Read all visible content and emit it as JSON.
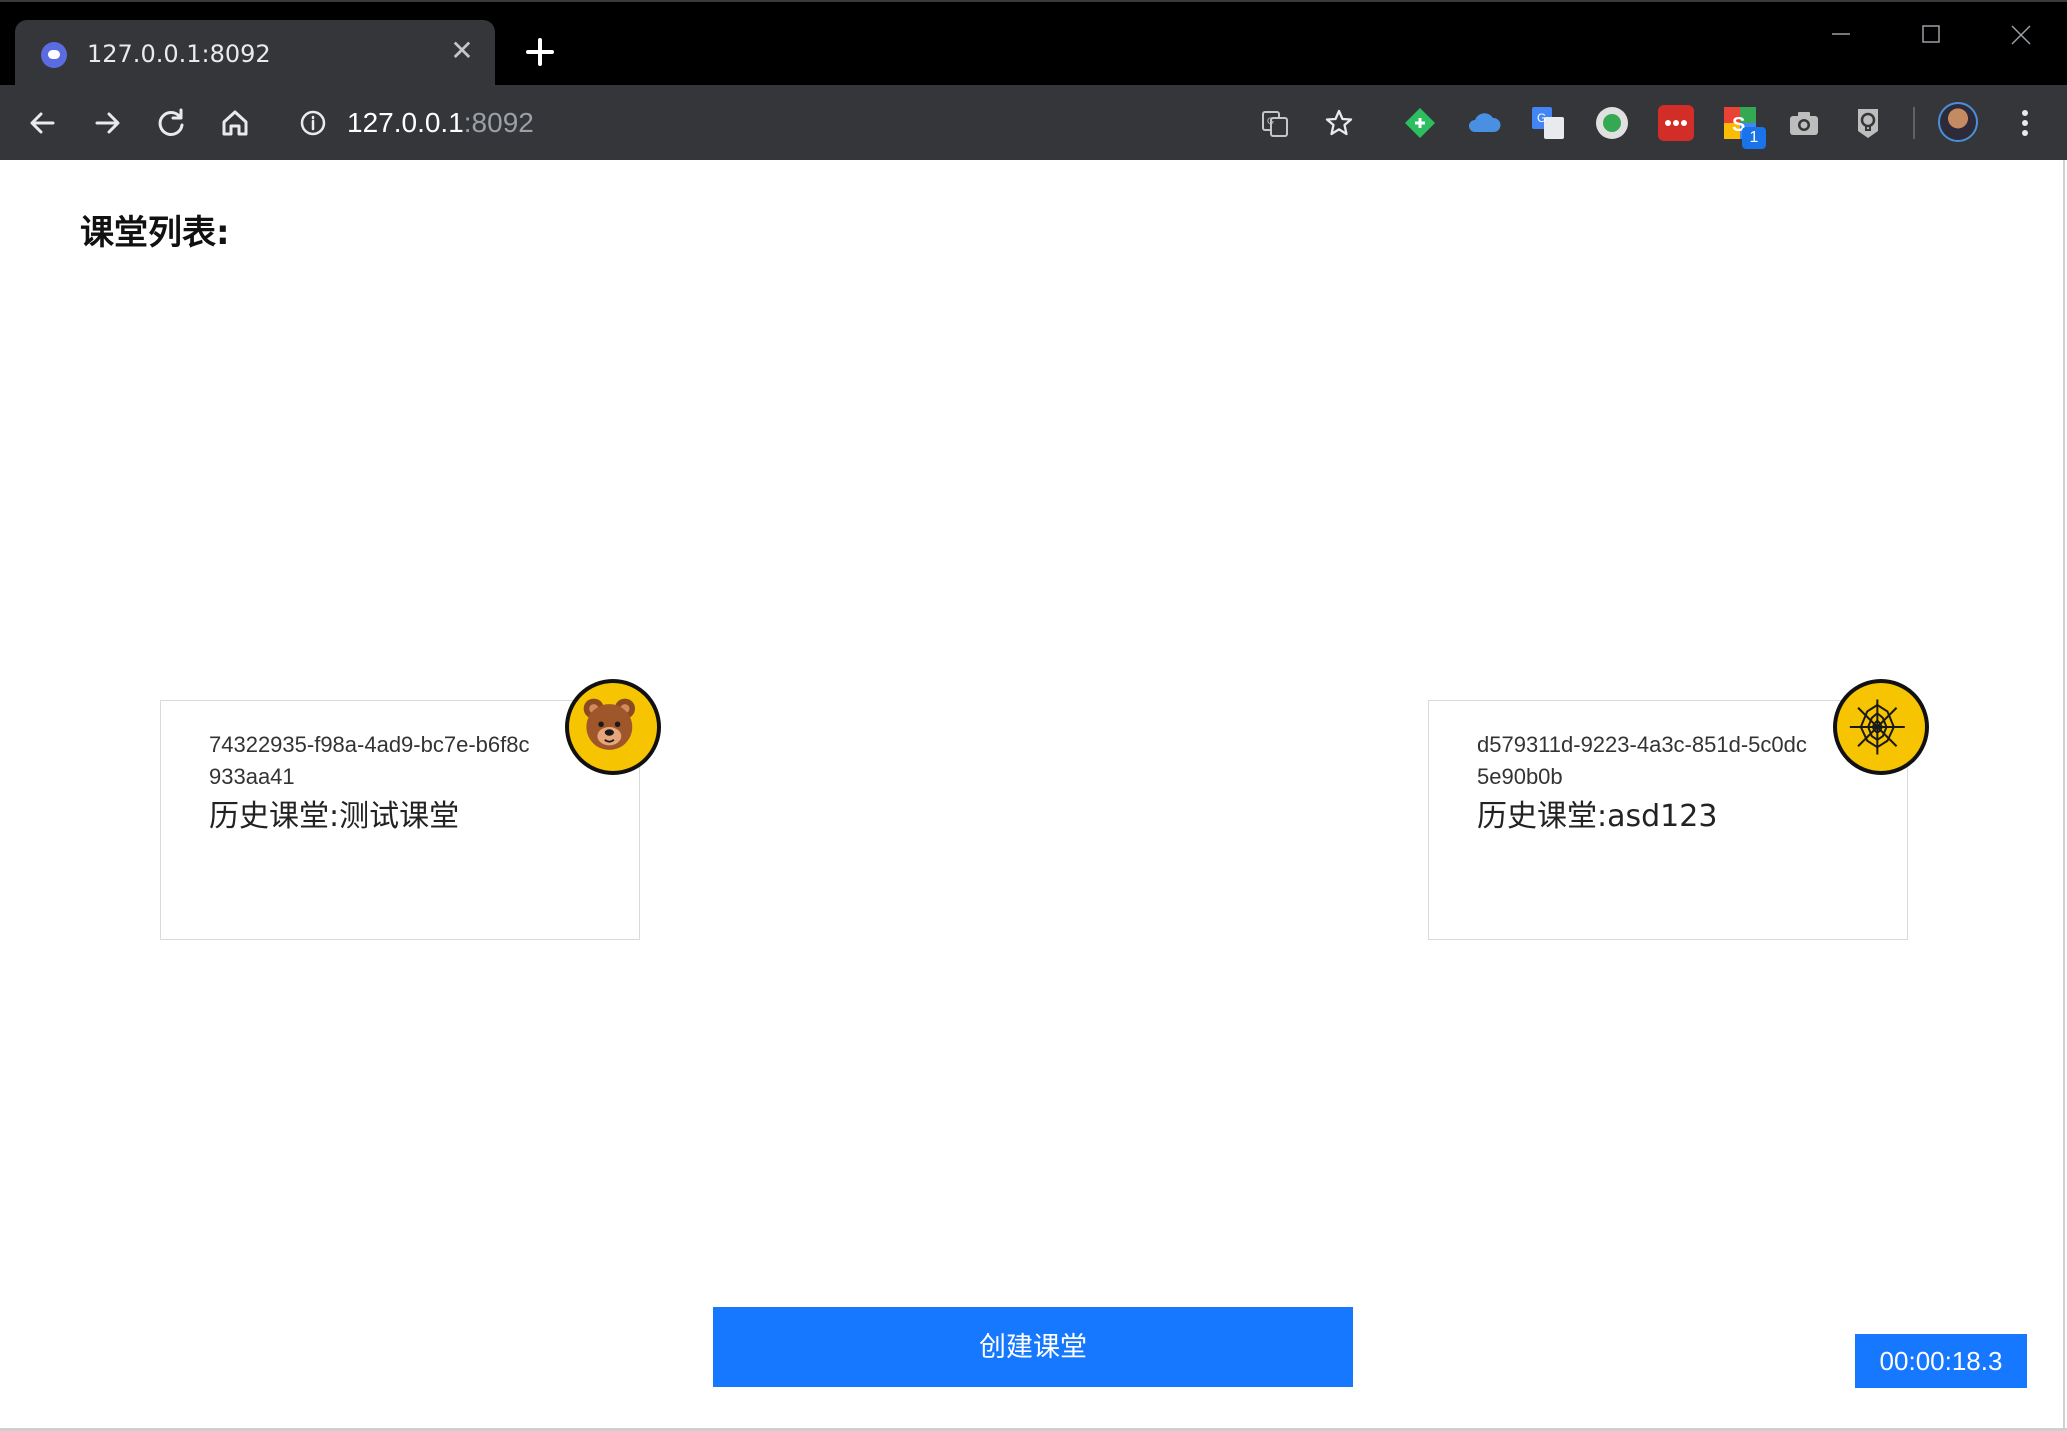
{
  "browser": {
    "tab_title": "127.0.0.1:8092",
    "url_host": "127.0.0.1",
    "url_port": ":8092",
    "extensions": [
      {
        "icon": "evernote-icon",
        "color": "#2dbe60"
      },
      {
        "icon": "cloud-icon",
        "color": "#4a90e2"
      },
      {
        "icon": "google-translate-icon",
        "color": "#4285f4"
      },
      {
        "icon": "green-dot-icon",
        "color": "#34a853"
      },
      {
        "icon": "lastpass-icon",
        "color": "#d32d27"
      },
      {
        "icon": "extension-s-icon",
        "color": "#ea4335",
        "badge": "1"
      },
      {
        "icon": "camera-icon",
        "color": "#bdbdbd"
      },
      {
        "icon": "lightbulb-icon",
        "color": "#bdbdbd"
      }
    ]
  },
  "page": {
    "title": "课堂列表:",
    "classrooms": [
      {
        "id": "74322935-f98a-4ad9-bc7e-b6f8c933aa41",
        "name": "历史课堂:测试课堂",
        "badge_icon": "bear-icon"
      },
      {
        "id": "d579311d-9223-4a3c-851d-5c0dc5e90b0b",
        "name": "历史课堂:asd123",
        "badge_icon": "spider-web-icon"
      }
    ],
    "create_button": "创建课堂",
    "timer": "00:00:18.3"
  },
  "colors": {
    "accent": "#1677ff",
    "badge": "#f6c400"
  }
}
